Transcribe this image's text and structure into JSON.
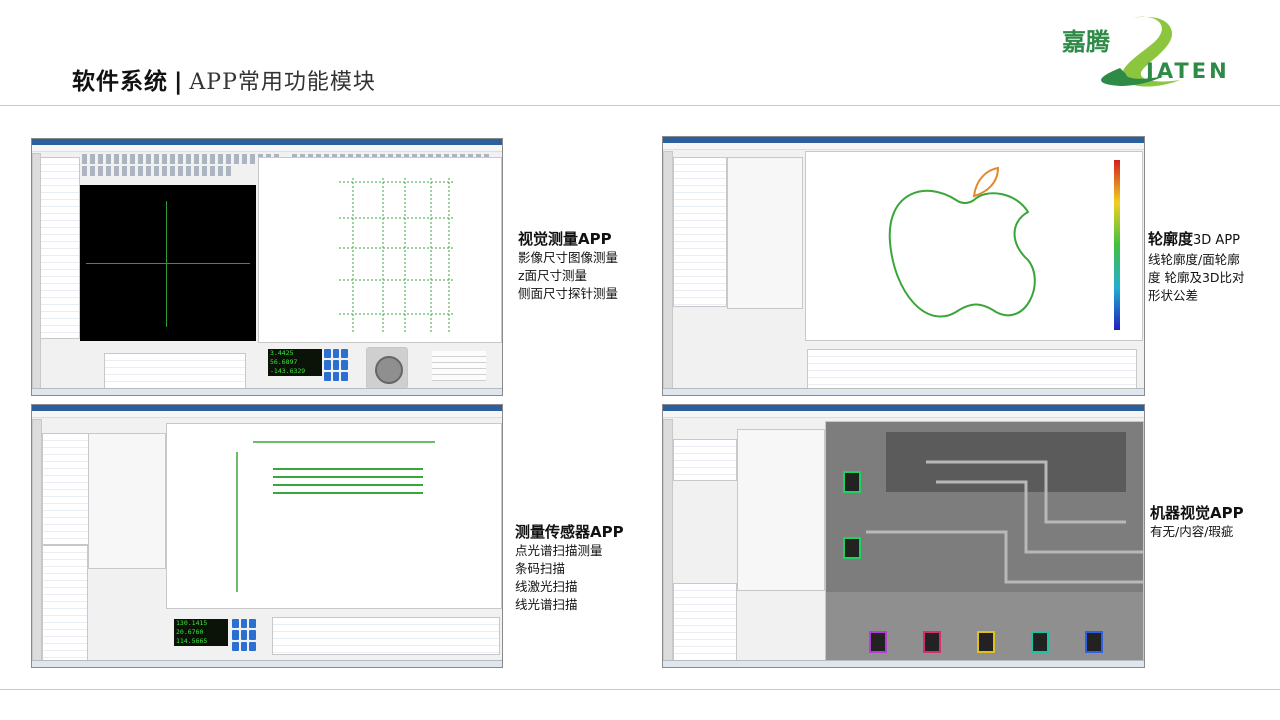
{
  "header": {
    "title_main": "软件系统",
    "title_sep": "|",
    "title_sub": "APP常用功能模块"
  },
  "logo": {
    "cn_text": "嘉腾",
    "en_text": "JATEN",
    "brand_color": "#2e8b47",
    "swoosh_color": "#8cc63f"
  },
  "apps": [
    {
      "name": "视觉测量APP",
      "lines": [
        "影像尺寸图像测量",
        "z面尺寸测量",
        "侧面尺寸探针测量"
      ],
      "readout": {
        "x": "3.4425",
        "y": "56.6897",
        "z": "-143.6329"
      }
    },
    {
      "name": "轮廓度",
      "name_suffix": "3D APP",
      "lines": [
        "线轮廓度/面轮廓",
        "度 轮廓及3D比对",
        "形状公差"
      ]
    },
    {
      "name": "测量传感器APP",
      "lines": [
        "点光谱扫描测量",
        "条码扫描",
        "线激光扫描",
        "线光谱扫描"
      ],
      "readout": {
        "x": "130.1415",
        "y": "20.6760",
        "z": "114.5665"
      }
    },
    {
      "name": "机器视觉APP",
      "lines": [
        "有无/内容/瑕疵"
      ]
    }
  ],
  "colors": {
    "window_titlebar": "#2d5f9e",
    "jog_button": "#2a6fd1",
    "readout_text": "#38e838"
  }
}
